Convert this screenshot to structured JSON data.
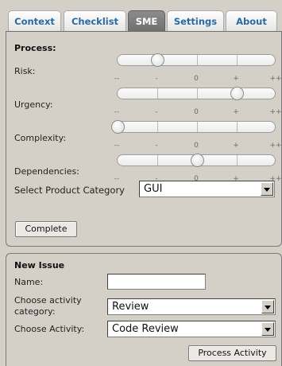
{
  "tabs": [
    {
      "label": "Context",
      "active": false
    },
    {
      "label": "Checklist",
      "active": false
    },
    {
      "label": "SME",
      "active": true
    },
    {
      "label": "Settings",
      "active": false
    },
    {
      "label": "About",
      "active": false
    }
  ],
  "process": {
    "title": "Process:",
    "scale": [
      "--",
      "-",
      "0",
      "+",
      "++"
    ],
    "sliders": [
      {
        "label": "Risk:",
        "value": "-"
      },
      {
        "label": "Urgency:",
        "value": "+"
      },
      {
        "label": "Complexity:",
        "value": "--"
      },
      {
        "label": "Dependencies:",
        "value": "0"
      }
    ],
    "category_label": "Select Product Category",
    "category_value": "GUI",
    "complete_label": "Complete"
  },
  "new_issue": {
    "title": "New Issue",
    "name_label": "Name:",
    "name_value": "",
    "activity_category_label": "Choose activity category:",
    "activity_category_value": "Review",
    "activity_label": "Choose Activity:",
    "activity_value": "Code Review",
    "process_button": "Process Activity"
  }
}
